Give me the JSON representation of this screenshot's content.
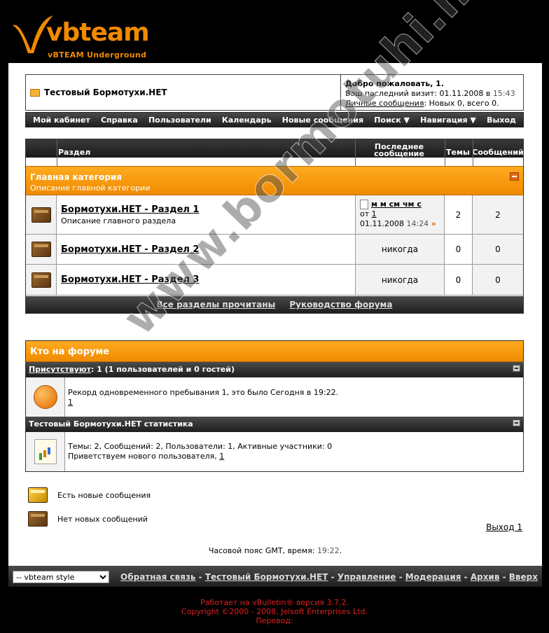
{
  "logo": {
    "brand": "vbteam",
    "subtitle": "vBTEAM Underground"
  },
  "header": {
    "forum_name": "Тестовый Бормотухи.НЕТ",
    "welcome": "Добро пожаловать, 1.",
    "last_visit_label": "Ваш последний визит: 01.11.2008 в",
    "last_visit_time": "15:43",
    "pm_link": "Личные сообщения",
    "pm_counts": ": Новых 0, всего 0."
  },
  "navbar": [
    "Мой кабинет",
    "Справка",
    "Пользователи",
    "Календарь",
    "Новые сообщения",
    "Поиск",
    "Навигация",
    "Выход"
  ],
  "forum_table": {
    "col_section": "Раздел",
    "col_last_post": "Последнее сообщение",
    "col_threads": "Темы",
    "col_posts": "Сообщений",
    "category": {
      "title": "Главная категория",
      "description": "Описание главной категории"
    },
    "forums": [
      {
        "title": "Бормотухи.НЕТ - Раздел 1",
        "description": "Описание главного раздела",
        "last_post_title": "м м см чм с",
        "last_post_from": "от",
        "last_post_user": "1",
        "last_post_date": "01.11.2008",
        "last_post_time": "14:24",
        "threads": "2",
        "posts": "2"
      },
      {
        "title": "Бормотухи.НЕТ - Раздел 2",
        "last_post": "никогда",
        "threads": "0",
        "posts": "0"
      },
      {
        "title": "Бормотухи.НЕТ - Раздел 3",
        "last_post": "никогда",
        "threads": "0",
        "posts": "0"
      }
    ],
    "footer_links": [
      "Все разделы прочитаны",
      "Руководство форума"
    ]
  },
  "whos_online": {
    "title": "Кто на форуме",
    "present_label": "Присутствуют",
    "present_text": ": 1 (1 пользователей и 0 гостей)",
    "record_text": "Рекорд одновременного пребывания 1, это было Сегодня в 19:22.",
    "record_user": "1",
    "stats_title": "Тестовый Бормотухи.НЕТ статистика",
    "stats_text": "Темы: 2, Сообщений: 2, Пользователи: 1, Активные участники: 0",
    "welcome_new": "Приветствуем нового пользователя,",
    "welcome_new_user": "1"
  },
  "legend": {
    "new_posts": "Есть новые сообщения",
    "no_new_posts": "Нет новых сообщений"
  },
  "logout": "Выход 1",
  "timezone": {
    "label": "Часовой пояс GMT, время:",
    "time": "19:22",
    "end": "."
  },
  "footer": {
    "style_select": "-- vbteam style",
    "links": [
      "Обратная связь",
      "Тестовый Бормотухи.НЕТ",
      "Управление",
      "Модерация",
      "Архив",
      "Вверх"
    ]
  },
  "copyright": {
    "line1": "Работает на vBulletin® версия 3.7.2.",
    "line2": "Copyright ©2000 - 2008, Jelsoft Enterprises Ltd.",
    "line3": "Перевод:"
  },
  "watermark": "www.bormotuhi.net",
  "colors": {
    "accent_orange": "#f08a00",
    "page_bg": "#000000",
    "footer_red": "#e02020"
  }
}
